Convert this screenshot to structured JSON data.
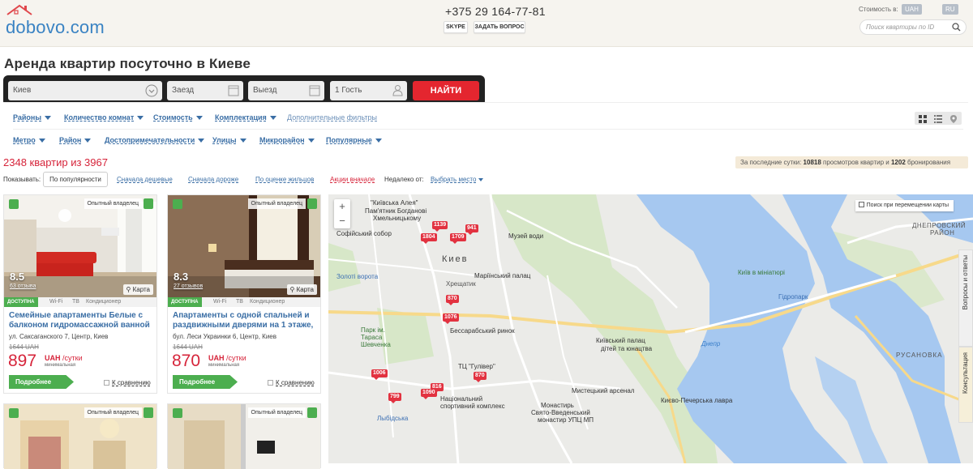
{
  "header": {
    "logo_text": "dobovo.com",
    "phone": "+375 29 164-77-81",
    "skype_label": "SKYPE",
    "ask_label": "ЗАДАТЬ ВОПРОС",
    "currency_label": "Стоимость в:",
    "currency_value": "UAH",
    "language_value": "RU",
    "search_placeholder": "Поиск квартиры по ID"
  },
  "page": {
    "title": "Аренда квартир посуточно в Киеве"
  },
  "searchbar": {
    "city": "Киев",
    "checkin_placeholder": "Заезд",
    "checkout_placeholder": "Выезд",
    "guests": "1 Гость",
    "find_label": "НАЙТИ"
  },
  "filters": {
    "row1": [
      "Районы",
      "Количество комнат",
      "Стоимость",
      "Комплектация"
    ],
    "extra": "Дополнительные фильтры",
    "row2": [
      "Метро",
      "Район",
      "Достопримечательности",
      "Улицы",
      "Микрорайон",
      "Популярные"
    ]
  },
  "results": {
    "count": "2348 квартир из 3967",
    "stats_prefix": "За последние сутки:",
    "views": "10818",
    "views_label": "просмотров квартир и",
    "bookings": "1202",
    "bookings_label": "бронирования"
  },
  "sort": {
    "label": "Показывать:",
    "active": "По популярности",
    "cheap": "Сначала дешевые",
    "expensive": "Сначала дороже",
    "rating": "По оценке жильцов",
    "promo": "Акции вначале",
    "near_label": "Недалеко от:",
    "place": "Выбрать место"
  },
  "cards": [
    {
      "owner": "Опытный владелец",
      "rating": "8.5",
      "reviews": "63 отзыва",
      "map_label": "Карта",
      "available": "ДОСТУПНА",
      "amenities": [
        "Wi-Fi",
        "ТВ",
        "Кондиционер"
      ],
      "title": "Семейные апартаменты Белые с балконом гидромассажной ванной",
      "address": "ул. Саксаганского 7, Центр, Киев",
      "old_price": "1644 UAH",
      "price": "897",
      "currency": "UAH",
      "per": "/сутки",
      "min_label": "минимальная",
      "more_label": "Подробнее",
      "compare_label": "К сравнению"
    },
    {
      "owner": "Опытный владелец",
      "rating": "8.3",
      "reviews": "27 отзывов",
      "map_label": "Карта",
      "available": "ДОСТУПНА",
      "amenities": [
        "Wi-Fi",
        "ТВ",
        "Кондиционер"
      ],
      "title": "Апартаменты с одной спальней и раздвижными дверями на 1 этаже,",
      "address": "бул. Леси Украинки 6, Центр, Киев",
      "old_price": "1644 UAH",
      "price": "870",
      "currency": "UAH",
      "per": "/сутки",
      "min_label": "минимальная",
      "more_label": "Подробнее",
      "compare_label": "К сравнению"
    },
    {
      "owner": "Опытный владелец"
    },
    {
      "owner": "Опытный владелец"
    }
  ],
  "map": {
    "search_on_move": "Поиск при перемещении карты",
    "side_faq": "Вопросы и ответы",
    "side_consult": "Консультация",
    "labels": {
      "pamyatnik": "Пам'ятник Богданові",
      "pamyatnik2": "Хмельницькому",
      "sofia": "Софійський собор",
      "kiev": "Киев",
      "mariinsky": "Маріїнський палац",
      "muzey": "Музей води",
      "bessarab": "Бессарабський ринок",
      "gulliver": "ТЦ \"Гулівер\"",
      "kreshchatyk": "Хрещатик",
      "arsenal": "Мистецький арсенал",
      "lavra": "Києво-Печерська лавра",
      "palace": "Київський палац",
      "palace2": "дітей та юнацтва",
      "complex": "Національний",
      "complex2": "спортивний комплекс",
      "monastery": "Монастирь",
      "monastery2": "Свято-Введенський",
      "monastery3": "монастир УПЦ МП",
      "miniature": "Київ в мініатюрі",
      "dnepr_district": "ДНЕПРОВСКИЙ",
      "dnepr_district2": "РАЙОН",
      "rusanovka": "РУСАНОВКА",
      "park": "Парк ім.",
      "park2": "Тараса",
      "park3": "Шевченка",
      "zoloti": "Золоті ворота",
      "lybidska": "Лыбідська",
      "dnipro_river": "Днепр",
      "gidropark": "Гідропарк",
      "arena": "\"Київська Алея\""
    },
    "pins": [
      "1139",
      "1804",
      "1709",
      "941",
      "870",
      "1076",
      "1006",
      "816",
      "870",
      "799",
      "1090"
    ]
  },
  "colors": {
    "accent": "#e4262f",
    "link": "#3a6ea5",
    "green": "#4cae4f",
    "price": "#d6243a"
  }
}
